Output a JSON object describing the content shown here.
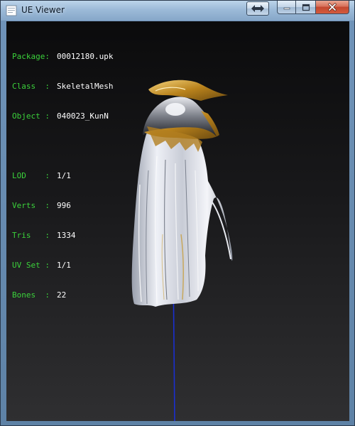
{
  "window": {
    "title": "UE Viewer",
    "icon": "app-icon"
  },
  "title_buttons": {
    "extra": "resize-arrows-icon",
    "minimize": "minimize-icon",
    "maximize": "maximize-icon",
    "close": "close-icon"
  },
  "info": {
    "package": {
      "label": "Package:",
      "value": "00012180.upk"
    },
    "class": {
      "label": "Class  :",
      "value": "SkeletalMesh"
    },
    "object": {
      "label": "Object :",
      "value": "040023_KunN"
    },
    "lod": {
      "label": "LOD    :",
      "value": "1/1"
    },
    "verts": {
      "label": "Verts  :",
      "value": "996"
    },
    "tris": {
      "label": "Tris   :",
      "value": "1334"
    },
    "uvset": {
      "label": "UV Set :",
      "value": "1/1"
    },
    "bones": {
      "label": "Bones  :",
      "value": "22"
    }
  },
  "colors": {
    "label": "#3bd23b",
    "value": "#ffffff",
    "axis": "#1a2fd0",
    "gold": "#c9961e"
  }
}
